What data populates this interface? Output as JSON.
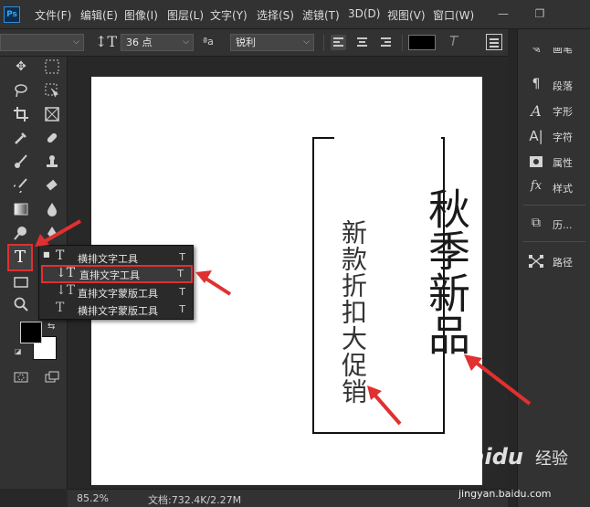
{
  "menubar": {
    "logo": "Ps",
    "items": [
      "文件(F)",
      "编辑(E)",
      "图像(I)",
      "图层(L)",
      "文字(Y)",
      "选择(S)",
      "滤镜(T)",
      "3D(D)",
      "视图(V)",
      "窗口(W)"
    ],
    "minimize_icon": "minimize-icon",
    "restore_icon": "restore-icon"
  },
  "options": {
    "font_size": "36 点",
    "aa_label": "ªa",
    "antialias": "锐利",
    "text_color": "#000000"
  },
  "flyout": {
    "items": [
      {
        "icon": "T",
        "label": "横排文字工具",
        "key": "T",
        "active_mark": "■"
      },
      {
        "icon": "↓T",
        "label": "直排文字工具",
        "key": "T",
        "active_mark": ""
      },
      {
        "icon": "↓T",
        "label": "直排文字蒙版工具",
        "key": "T",
        "active_mark": ""
      },
      {
        "icon": "T",
        "label": "横排文字蒙版工具",
        "key": "T",
        "active_mark": ""
      }
    ]
  },
  "canvas": {
    "small_text": "新款折扣大促销",
    "big_text": "秋季新品"
  },
  "statusbar": {
    "zoom": "85.2%",
    "doc": "文档:732.4K/2.27M"
  },
  "panels": {
    "items": [
      {
        "icon": "brush-panel-icon",
        "label": "画笔"
      },
      {
        "icon": "paragraph-icon",
        "label": "段落"
      },
      {
        "icon": "character-icon",
        "label": "字形"
      },
      {
        "icon": "character-style-icon",
        "label": "字符"
      },
      {
        "icon": "properties-icon",
        "label": "属性"
      },
      {
        "icon": "fx-icon",
        "label": "样式"
      },
      {
        "icon": "history-icon",
        "label": "历..."
      },
      {
        "icon": "paths-icon",
        "label": "路径"
      }
    ]
  },
  "watermark": {
    "brand": "Baidu",
    "cn": "经验",
    "url": "jingyan.baidu.com"
  },
  "colors": {
    "highlight": "#e03030",
    "foreground": "#000000",
    "background": "#ffffff"
  }
}
